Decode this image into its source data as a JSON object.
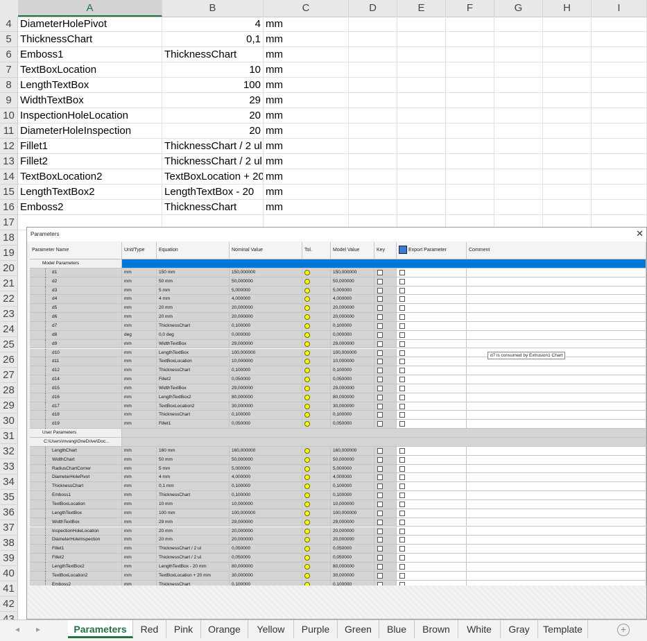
{
  "columns": [
    "A",
    "B",
    "C",
    "D",
    "E",
    "F",
    "G",
    "H",
    "I"
  ],
  "rows": [
    {
      "n": "4",
      "a": "DiameterHolePivot",
      "b": "4",
      "b_num": true,
      "c": "mm"
    },
    {
      "n": "5",
      "a": "ThicknessChart",
      "b": "0,1",
      "b_num": true,
      "c": "mm"
    },
    {
      "n": "6",
      "a": "Emboss1",
      "b": "ThicknessChart",
      "b_num": false,
      "c": "mm"
    },
    {
      "n": "7",
      "a": "TextBoxLocation",
      "b": "10",
      "b_num": true,
      "c": "mm"
    },
    {
      "n": "8",
      "a": "LengthTextBox",
      "b": "100",
      "b_num": true,
      "c": "mm"
    },
    {
      "n": "9",
      "a": "WidthTextBox",
      "b": "29",
      "b_num": true,
      "c": "mm"
    },
    {
      "n": "10",
      "a": "InspectionHoleLocation",
      "b": "20",
      "b_num": true,
      "c": "mm"
    },
    {
      "n": "11",
      "a": "DiameterHoleInspection",
      "b": "20",
      "b_num": true,
      "c": "mm"
    },
    {
      "n": "12",
      "a": "Fillet1",
      "b": "ThicknessChart / 2 ul",
      "b_num": false,
      "c": "mm"
    },
    {
      "n": "13",
      "a": "Fillet2",
      "b": "ThicknessChart / 2 ul",
      "b_num": false,
      "c": "mm"
    },
    {
      "n": "14",
      "a": "TextBoxLocation2",
      "b": "TextBoxLocation + 20",
      "b_num": false,
      "c": "mm"
    },
    {
      "n": "15",
      "a": "LengthTextBox2",
      "b": "LengthTextBox  - 20",
      "b_num": false,
      "c": "mm"
    },
    {
      "n": "16",
      "a": "Emboss2",
      "b": "ThicknessChart",
      "b_num": false,
      "c": "mm"
    },
    {
      "n": "17",
      "a": "",
      "b": "",
      "b_num": false,
      "c": ""
    }
  ],
  "extra_row_numbers": [
    "18",
    "19",
    "20",
    "21",
    "22",
    "23",
    "24",
    "25",
    "26",
    "27",
    "28",
    "29",
    "30",
    "31",
    "32",
    "33",
    "34",
    "35",
    "36",
    "37",
    "38",
    "39",
    "40",
    "41",
    "42",
    "43"
  ],
  "dialog": {
    "title": "Parameters",
    "close": "✕",
    "headers": [
      "Parameter Name",
      "Unit/Type",
      "Equation",
      "Nominal Value",
      "Tol.",
      "Model Value",
      "Key",
      "Export Parameter",
      "Comment"
    ],
    "tooltip": "d7 is consumed by Extrusion1 Chart",
    "group_model": "Model Parameters",
    "model_params": [
      [
        "d1",
        "mm",
        "150 mm",
        "150,000000",
        "150,000000"
      ],
      [
        "d2",
        "mm",
        "50 mm",
        "50,000000",
        "50,000000"
      ],
      [
        "d3",
        "mm",
        "5 mm",
        "5,000000",
        "5,000000"
      ],
      [
        "d4",
        "mm",
        "4 mm",
        "4,000000",
        "4,000000"
      ],
      [
        "d5",
        "mm",
        "20 mm",
        "20,000000",
        "20,000000"
      ],
      [
        "d6",
        "mm",
        "20 mm",
        "20,000000",
        "20,000000"
      ],
      [
        "d7",
        "mm",
        "ThicknessChart",
        "0,100000",
        "0,100000"
      ],
      [
        "d8",
        "deg",
        "0,0 deg",
        "0,000000",
        "0,000000"
      ],
      [
        "d9",
        "mm",
        "WidthTextBox",
        "29,000000",
        "29,000000"
      ],
      [
        "d10",
        "mm",
        "LengthTextBox",
        "100,000000",
        "100,000000"
      ],
      [
        "d11",
        "mm",
        "TextBoxLocation",
        "10,000000",
        "10,000000"
      ],
      [
        "d12",
        "mm",
        "ThicknessChart",
        "0,100000",
        "0,100000"
      ],
      [
        "d14",
        "mm",
        "Fillet2",
        "0,050000",
        "0,050000"
      ],
      [
        "d15",
        "mm",
        "WidthTextBox",
        "29,000000",
        "29,000000"
      ],
      [
        "d16",
        "mm",
        "LengthTextBox2",
        "80,000000",
        "80,000000"
      ],
      [
        "d17",
        "mm",
        "TextBoxLocation2",
        "30,000000",
        "30,000000"
      ],
      [
        "d18",
        "mm",
        "ThicknessChart",
        "0,100000",
        "0,100000"
      ],
      [
        "d19",
        "mm",
        "Fillet1",
        "0,050000",
        "0,050000"
      ]
    ],
    "group_user": "User Parameters",
    "group_path": "C:\\Users\\mvang\\OneDrive\\Doc...",
    "user_params": [
      [
        "LengthChart",
        "mm",
        "160 mm",
        "160,000000",
        "160,000000"
      ],
      [
        "WidthChart",
        "mm",
        "50 mm",
        "50,000000",
        "50,000000"
      ],
      [
        "RadiusChartCorner",
        "mm",
        "5 mm",
        "5,000000",
        "5,000000"
      ],
      [
        "DiameterHolePivot",
        "mm",
        "4 mm",
        "4,000000",
        "4,000000"
      ],
      [
        "ThicknessChart",
        "mm",
        "0,1 mm",
        "0,100000",
        "0,100000"
      ],
      [
        "Emboss1",
        "mm",
        "ThicknessChart",
        "0,100000",
        "0,100000"
      ],
      [
        "TextBoxLocation",
        "mm",
        "10 mm",
        "10,000000",
        "10,000000"
      ],
      [
        "LengthTextBox",
        "mm",
        "100 mm",
        "100,000000",
        "100,000000"
      ],
      [
        "WidthTextBox",
        "mm",
        "29 mm",
        "29,000000",
        "29,000000"
      ],
      [
        "InspectionHoleLocation",
        "mm",
        "20 mm",
        "20,000000",
        "20,000000"
      ],
      [
        "DiameterHoleInspection",
        "mm",
        "20 mm",
        "20,000000",
        "20,000000"
      ],
      [
        "Fillet1",
        "mm",
        "ThicknessChart / 2 ul",
        "0,050000",
        "0,050000"
      ],
      [
        "Fillet2",
        "mm",
        "ThicknessChart / 2 ul",
        "0,050000",
        "0,050000"
      ],
      [
        "LengthTextBox2",
        "mm",
        "LengthTextBox - 20 mm",
        "80,000000",
        "80,000000"
      ],
      [
        "TextBoxLocation2",
        "mm",
        "TextBoxLocation + 20 mm",
        "30,000000",
        "30,000000"
      ],
      [
        "Emboss2",
        "mm",
        "ThicknessChart",
        "0,100000",
        "0,100000"
      ]
    ]
  },
  "tabs": {
    "nav_prev": "◂",
    "nav_next": "▸",
    "items": [
      "Parameters",
      "Red",
      "Pink",
      "Orange",
      "Yellow",
      "Purple",
      "Green",
      "Blue",
      "Brown",
      "White",
      "Gray",
      "Template"
    ],
    "active": "Parameters",
    "add": "+"
  },
  "colors": {
    "accent": "#217346",
    "selection": "#0078d7",
    "tolerance": "#ffff00"
  }
}
